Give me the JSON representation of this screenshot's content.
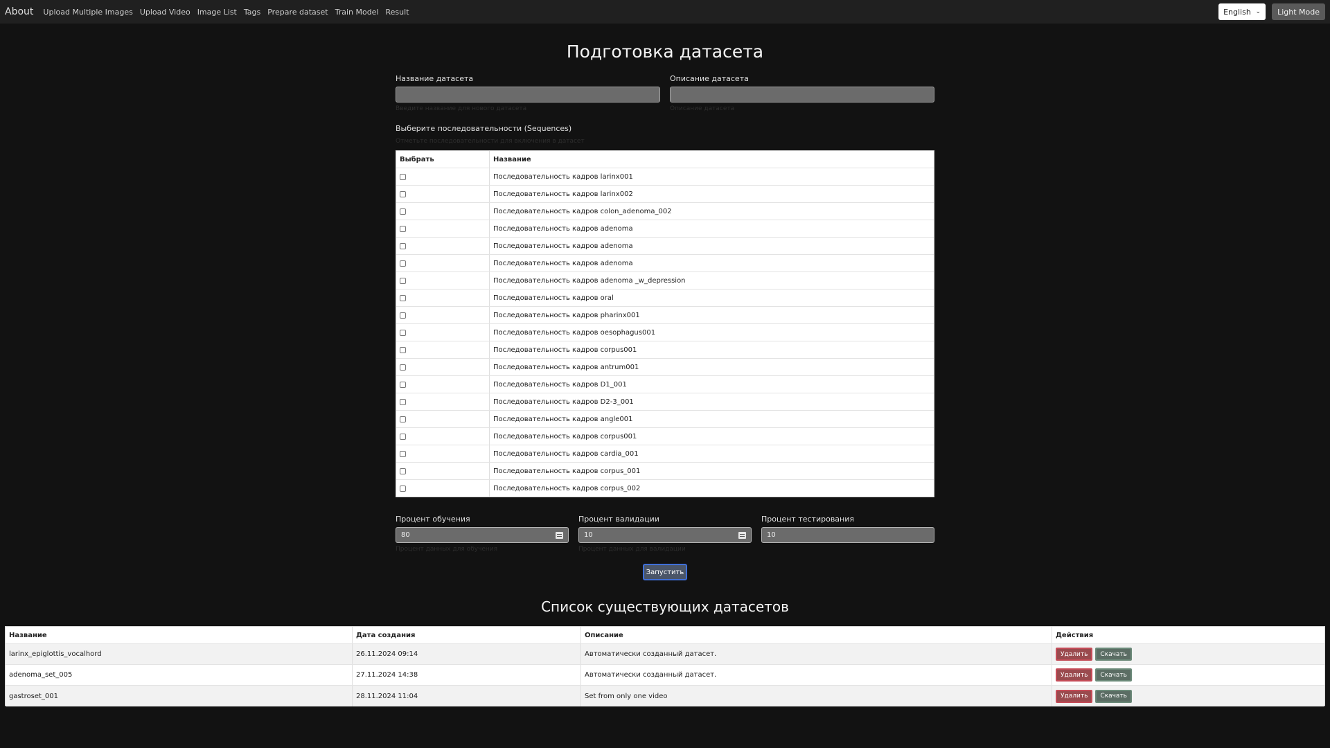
{
  "nav": {
    "brand": "About",
    "links": [
      "Upload Multiple Images",
      "Upload Video",
      "Image List",
      "Tags",
      "Prepare dataset",
      "Train Model",
      "Result"
    ],
    "language": "English",
    "mode_button": "Light Mode"
  },
  "form": {
    "title": "Подготовка датасета",
    "name_label": "Название датасета",
    "name_value": "",
    "name_hint": "Введите название для нового датасета",
    "desc_label": "Описание датасета",
    "desc_value": "",
    "desc_hint": "Описание датасета",
    "sequences_label": "Выберите последовательности (Sequences)",
    "sequences_hint": "Отметьте последовательности для включения в датасет"
  },
  "seq_table": {
    "headers": [
      "Выбрать",
      "Название"
    ],
    "rows": [
      "Последовательность кадров larinx001",
      "Последовательность кадров larinx002",
      "Последовательность кадров colon_adenoma_002",
      "Последовательность кадров adenoma",
      "Последовательность кадров adenoma",
      "Последовательность кадров adenoma",
      "Последовательность кадров adenoma _w_depression",
      "Последовательность кадров oral",
      "Последовательность кадров pharinx001",
      "Последовательность кадров oesophagus001",
      "Последовательность кадров corpus001",
      "Последовательность кадров antrum001",
      "Последовательность кадров D1_001",
      "Последовательность кадров D2-3_001",
      "Последовательность кадров angle001",
      "Последовательность кадров corpus001",
      "Последовательность кадров cardia_001",
      "Последовательность кадров corpus_001",
      "Последовательность кадров corpus_002"
    ]
  },
  "split": {
    "train_label": "Процент обучения",
    "train_value": "80",
    "train_hint": "Процент данных для обучения",
    "val_label": "Процент валидации",
    "val_value": "10",
    "val_hint": "Процент данных для валидации",
    "test_label": "Процент тестирования",
    "test_value": "10"
  },
  "run_button": "Запустить",
  "datasets": {
    "title": "Список существующих датасетов",
    "headers": [
      "Название",
      "Дата создания",
      "Описание",
      "Действия"
    ],
    "delete_label": "Удалить",
    "download_label": "Скачать",
    "rows": [
      {
        "name": "larinx_epiglottis_vocalhord",
        "date": "26.11.2024 09:14",
        "desc": "Автоматически созданный датасет."
      },
      {
        "name": "adenoma_set_005",
        "date": "27.11.2024 14:38",
        "desc": "Автоматически созданный датасет."
      },
      {
        "name": "gastroset_001",
        "date": "28.11.2024 11:04",
        "desc": "Set from only one video"
      }
    ]
  }
}
